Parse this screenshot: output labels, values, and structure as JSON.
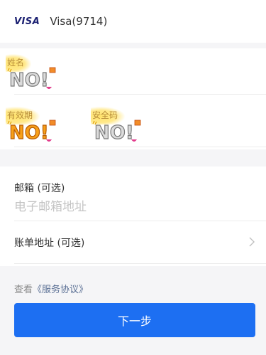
{
  "card": {
    "brand_logo": "VISA",
    "label": "Visa(9714)"
  },
  "card_fields": {
    "name_label": "姓名",
    "expiry_label": "有效期",
    "cvv_label": "安全码",
    "sticker_text": "NO!"
  },
  "email": {
    "label": "邮箱 (可选)",
    "placeholder": "电子邮箱地址"
  },
  "billing": {
    "label": "账单地址 (可选)"
  },
  "terms": {
    "prefix": "查看",
    "link": "《服务协议》"
  },
  "next_button": {
    "label": "下一步"
  },
  "colors": {
    "primary": "#1d6ff2",
    "visa_blue": "#1a1f71",
    "sticker_yellow": "#ffe164",
    "background": "#f5f5f7"
  }
}
